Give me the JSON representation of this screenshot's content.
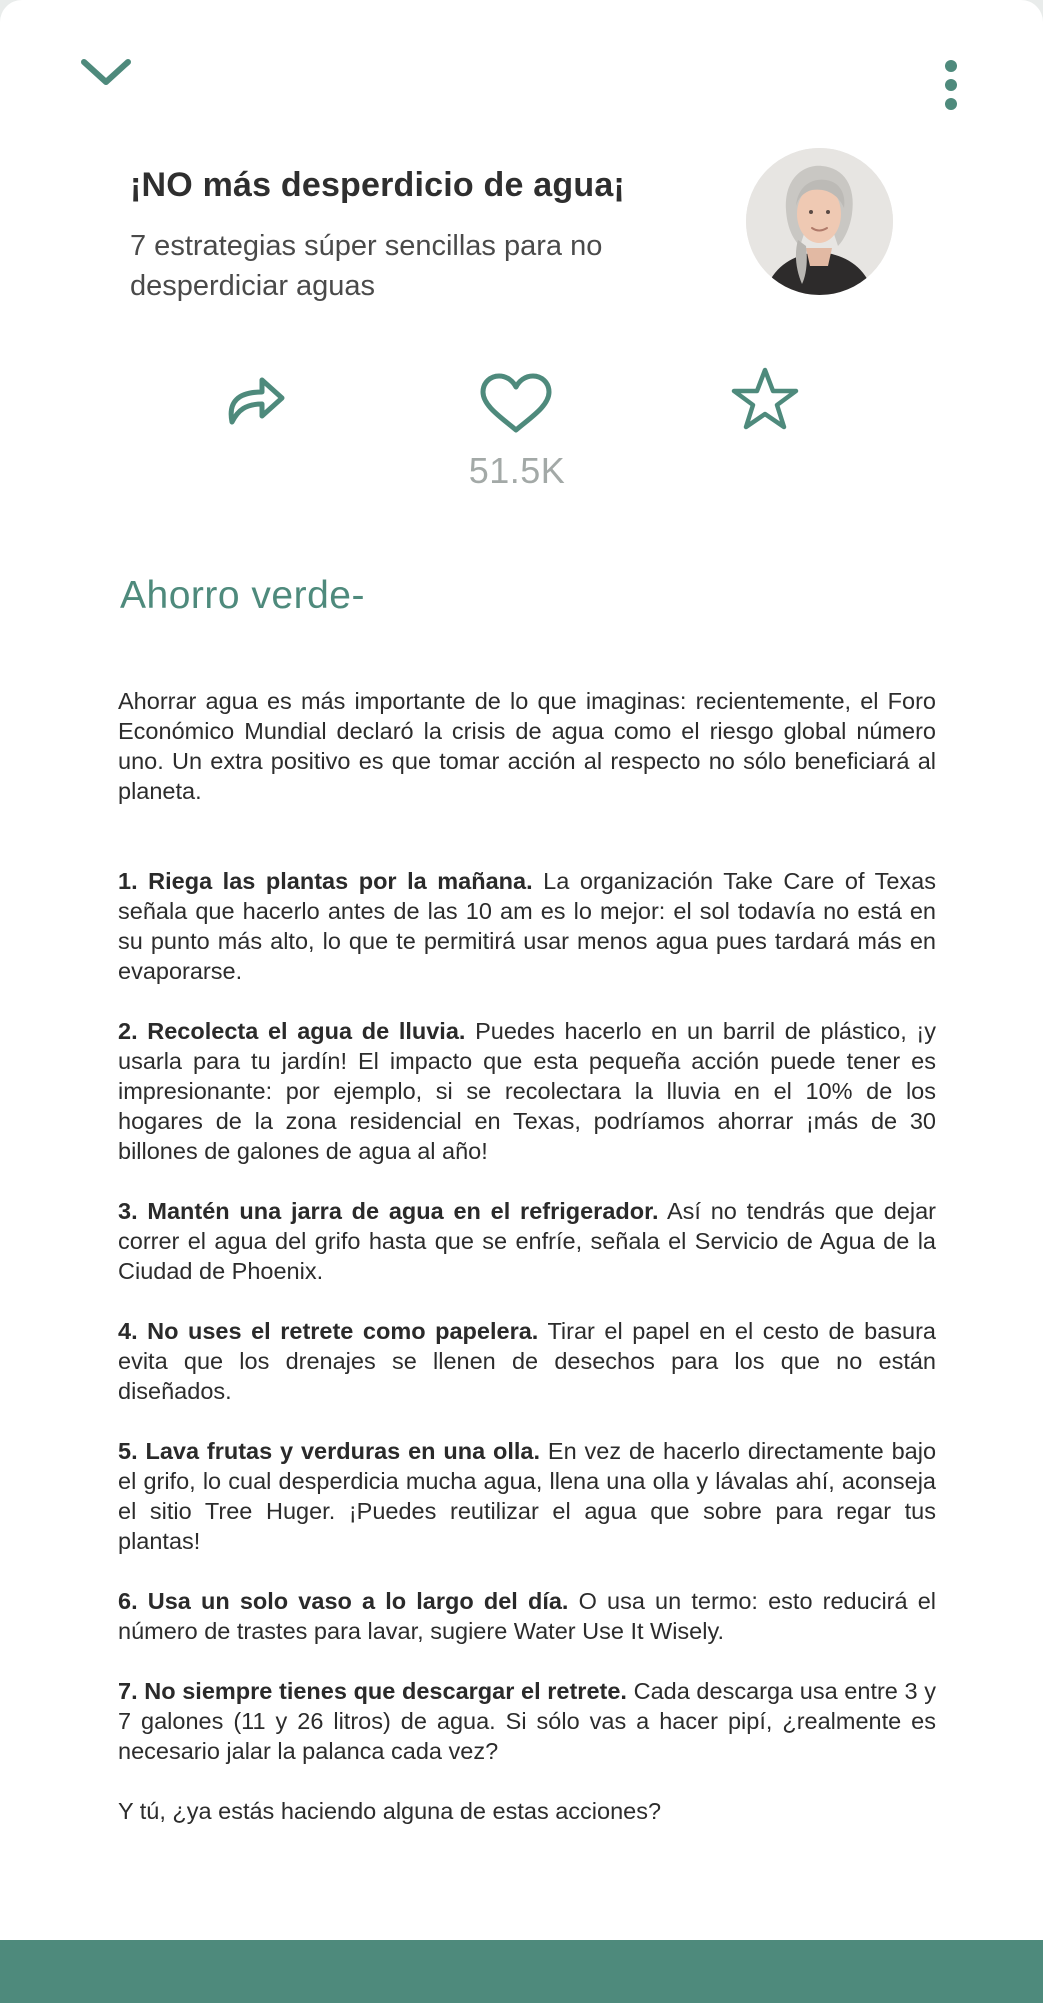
{
  "colors": {
    "accent": "#4e8a7c",
    "muted": "#a3a9a7",
    "background": "#ffffff"
  },
  "header": {
    "collapse_icon": "chevron-down-icon",
    "menu_icon": "more-vertical-icon",
    "title": "¡NO más desperdicio de agua¡",
    "subtitle": "7 estrategias súper sencillas para no desperdiciar aguas"
  },
  "author": {
    "avatar_icon": "author-avatar"
  },
  "actions": {
    "share_icon": "share-icon",
    "like_icon": "heart-icon",
    "likes_count": "51.5K",
    "save_icon": "star-icon"
  },
  "article": {
    "section_title": "Ahorro verde-",
    "intro": "Ahorrar agua es más importante de lo que imaginas: recientemente, el Foro Económico Mundial declaró la crisis de agua como el riesgo global número uno. Un extra positivo es que tomar acción al respecto no sólo beneficiará al planeta.",
    "tips": [
      {
        "heading": "1. Riega las plantas por la mañana.",
        "text": " La organización Take Care of Texas señala que hacerlo antes de las 10 am es lo mejor: el sol todavía no está en su punto más alto, lo que te permitirá usar menos agua pues tardará más en evaporarse."
      },
      {
        "heading": "2. Recolecta el agua de lluvia.",
        "text": " Puedes hacerlo en un barril de plástico, ¡y usarla para tu jardín! El impacto que esta pequeña acción puede tener es impresionante: por ejemplo, si se recolectara la lluvia en el 10% de los hogares de la zona residencial en Texas, podríamos ahorrar ¡más de 30 billones de galones de agua al año!"
      },
      {
        "heading": "3. Mantén una jarra de agua en el refrigerador.",
        "text": " Así no tendrás que dejar correr el agua del grifo hasta que se enfríe, señala el Servicio de Agua de la Ciudad de Phoenix."
      },
      {
        "heading": "4. No uses el retrete como papelera.",
        "text": " Tirar el papel en el cesto de basura evita que los drenajes se llenen de desechos para los que no están diseñados."
      },
      {
        "heading": "5. Lava frutas y verduras en una olla.",
        "text": " En vez de hacerlo directamente bajo el grifo, lo cual desperdicia mucha agua, llena una olla y lávalas ahí, aconseja el sitio Tree Huger. ¡Puedes reutilizar el agua que sobre para regar tus plantas!"
      },
      {
        "heading": "6. Usa un solo vaso a lo largo del día.",
        "text": " O usa un termo: esto reducirá el número de trastes para lavar, sugiere Water Use It Wisely."
      },
      {
        "heading": "7. No siempre tienes que descargar el retrete.",
        "text": " Cada descarga usa entre 3 y 7 galones (11 y 26 litros) de agua. Si sólo vas a hacer pipí, ¿realmente es necesario jalar la palanca cada vez?"
      }
    ],
    "closing": "Y tú, ¿ya estás haciendo alguna de estas acciones?"
  }
}
